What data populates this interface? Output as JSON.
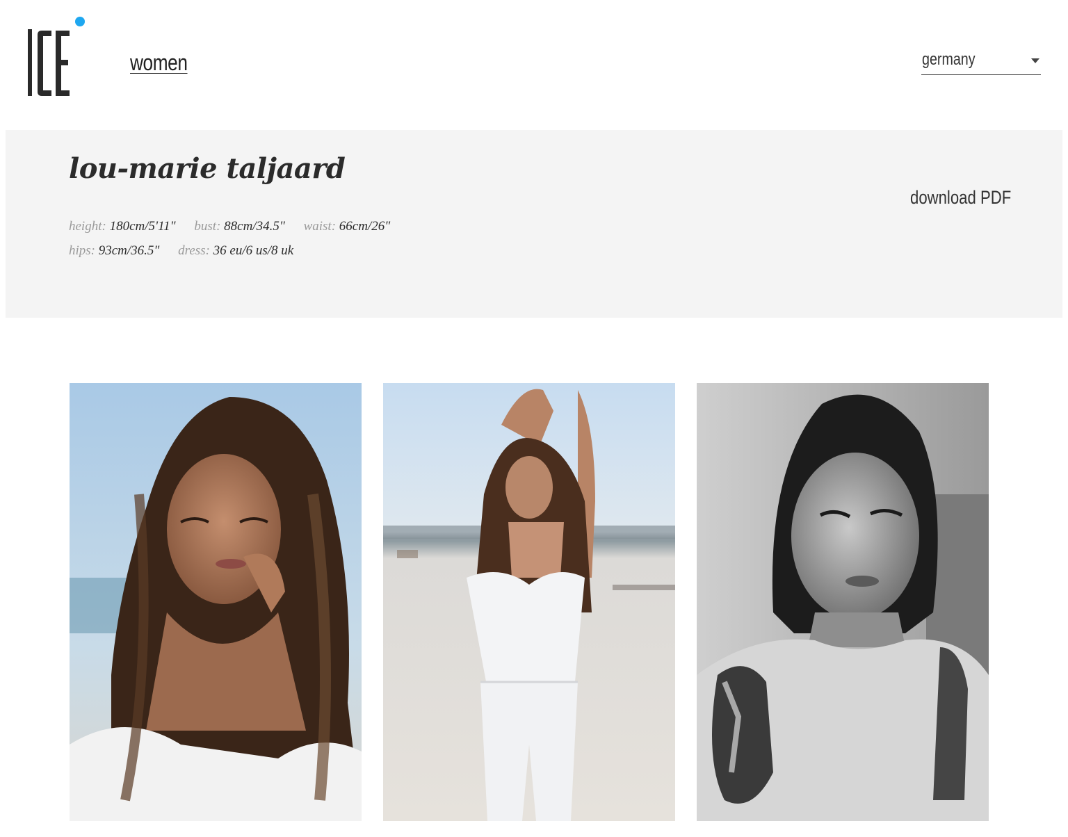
{
  "header": {
    "logo_alt": "ICE",
    "nav": {
      "women_label": "women"
    },
    "country_select": {
      "value": "germany"
    }
  },
  "profile": {
    "name": "lou-marie taljaard",
    "download_label": "download PDF",
    "measurements_row1": [
      {
        "key": "height:",
        "value": "180cm/5'11\""
      },
      {
        "key": "bust:",
        "value": "88cm/34.5\""
      },
      {
        "key": "waist:",
        "value": "66cm/26\""
      }
    ],
    "measurements_row2": [
      {
        "key": "hips:",
        "value": "93cm/36.5\""
      },
      {
        "key": "dress:",
        "value": "36 eu/6 us/8 uk"
      }
    ]
  },
  "gallery": {
    "photos": [
      {
        "name": "portrait-color",
        "tone": "color"
      },
      {
        "name": "beach-full-body",
        "tone": "color"
      },
      {
        "name": "portrait-bw",
        "tone": "monochrome"
      }
    ]
  },
  "colors": {
    "accent_dot": "#1ea7f0",
    "panel_bg": "#f4f4f4"
  }
}
